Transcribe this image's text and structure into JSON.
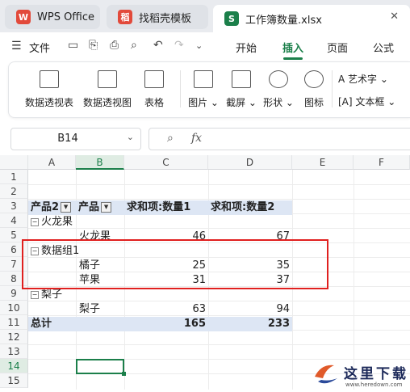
{
  "tabs": [
    {
      "label": "WPS Office",
      "icon": "W",
      "icon_color": "#e24a3b"
    },
    {
      "label": "找稻壳模板",
      "icon": "稻",
      "icon_color": "#e24a3b"
    },
    {
      "label": "工作簿数量.xlsx",
      "icon": "S",
      "icon_color": "#1b7f4a",
      "close": "✕"
    }
  ],
  "menu": {
    "file": "文件",
    "items": [
      "开始",
      "插入",
      "页面",
      "公式"
    ],
    "active": "插入"
  },
  "ribbon": {
    "buttons": [
      {
        "label": "数据透视表",
        "icon": "pivot-table-icon"
      },
      {
        "label": "数据透视图",
        "icon": "pivot-chart-icon"
      },
      {
        "label": "表格",
        "icon": "table-icon"
      },
      {
        "label": "图片 ⌄",
        "icon": "picture-icon"
      },
      {
        "label": "截屏 ⌄",
        "icon": "screenshot-icon"
      },
      {
        "label": "形状 ⌄",
        "icon": "shapes-icon"
      },
      {
        "label": "图标",
        "icon": "icons-icon"
      }
    ],
    "art_text": "艺术字 ⌄",
    "text_box": "文本框 ⌄"
  },
  "formula": {
    "cell_ref": "B14",
    "fx": "fx"
  },
  "columns": [
    "A",
    "B",
    "C",
    "D",
    "E",
    "F"
  ],
  "selected_column": "B",
  "rows": [
    "1",
    "2",
    "3",
    "4",
    "5",
    "6",
    "7",
    "8",
    "9",
    "10",
    "11",
    "12",
    "13",
    "14",
    "15"
  ],
  "selected_row": "14",
  "pivot": {
    "header": [
      "产品2",
      "产品",
      "求和项:数量1",
      "求和项:数量2"
    ],
    "row4_group": "火龙果",
    "row5": [
      "火龙果",
      "46",
      "67"
    ],
    "row6_group": "数据组1",
    "row7": [
      "橘子",
      "25",
      "35"
    ],
    "row8": [
      "苹果",
      "31",
      "37"
    ],
    "row9_group": "梨子",
    "row10": [
      "梨子",
      "63",
      "94"
    ],
    "total": [
      "总计",
      "165",
      "233"
    ]
  },
  "watermark": {
    "text": "这里下载",
    "url": "www.heredown.com"
  },
  "colors": {
    "accent": "#1b7f4a",
    "highlight_border": "#e0201f",
    "pivot_header_bg": "#dde6f4"
  }
}
